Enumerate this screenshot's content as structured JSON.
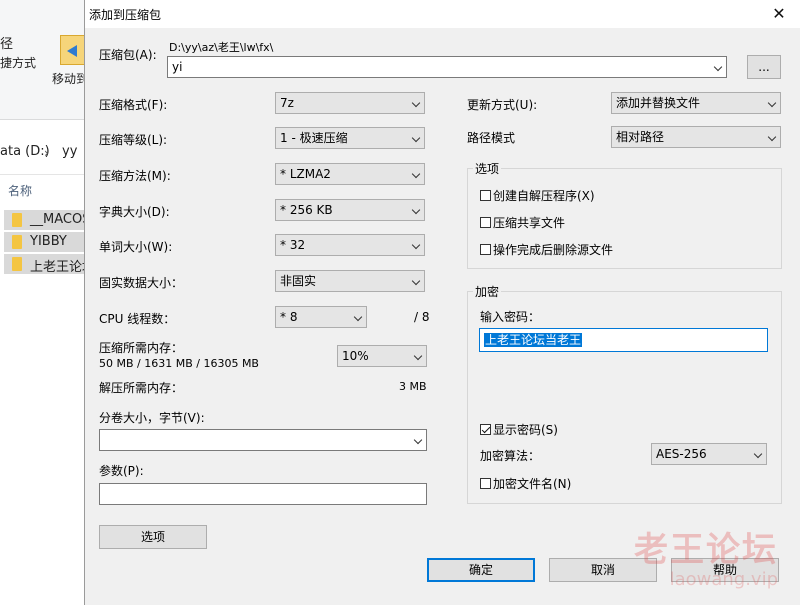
{
  "explorer": {
    "ribbon_text1": "径",
    "ribbon_text2": "捷方式",
    "move_label": "移动到",
    "path_prefix": "ata (D:)",
    "path_folder": "yy",
    "col_name": "名称",
    "items": [
      "__MACOS",
      "YIBBY",
      "上老王论坛"
    ]
  },
  "dialog": {
    "title": "添加到压缩包",
    "archive_label": "压缩包(A):",
    "archive_path": "D:\\yy\\az\\老王\\lw\\fx\\",
    "archive_name": "yi",
    "browse_label": "...",
    "format_label": "压缩格式(F):",
    "format_value": "7z",
    "level_label": "压缩等级(L):",
    "level_value": "1 - 极速压缩",
    "method_label": "压缩方法(M):",
    "method_value": "* LZMA2",
    "dict_label": "字典大小(D):",
    "dict_value": "* 256 KB",
    "word_label": "单词大小(W):",
    "word_value": "* 32",
    "solid_label": "固实数据大小：",
    "solid_value": "非固实",
    "cpu_label": "CPU 线程数：",
    "cpu_value": "* 8",
    "cpu_total": "/ 8",
    "mem_comp_label": "压缩所需内存：",
    "mem_comp_detail": "50 MB / 1631 MB / 16305 MB",
    "mem_percent": "10%",
    "mem_decomp_label": "解压所需内存：",
    "mem_decomp_value": "3 MB",
    "split_label": "分卷大小，字节(V):",
    "split_value": "",
    "params_label": "参数(P):",
    "params_value": "",
    "options_button": "选项",
    "update_label": "更新方式(U):",
    "update_value": "添加并替换文件",
    "pathmode_label": "路径模式",
    "pathmode_value": "相对路径",
    "options_group": "选项",
    "opt_sfx": "创建自解压程序(X)",
    "opt_shared": "压缩共享文件",
    "opt_delete": "操作完成后删除源文件",
    "encryption_group": "加密",
    "password_label": "输入密码：",
    "password_value": "上老王论坛当老王",
    "show_password": "显示密码(S)",
    "enc_method_label": "加密算法：",
    "enc_method_value": "AES-256",
    "encrypt_names": "加密文件名(N)",
    "ok_button": "确定",
    "cancel_button": "取消",
    "help_button": "帮助",
    "close_symbol": "✕"
  },
  "watermark": {
    "cn": "老王论坛",
    "en": "laowang.vip"
  },
  "colors": {
    "accent": "#0078d7",
    "dialog_bg": "#f0f0f0"
  }
}
